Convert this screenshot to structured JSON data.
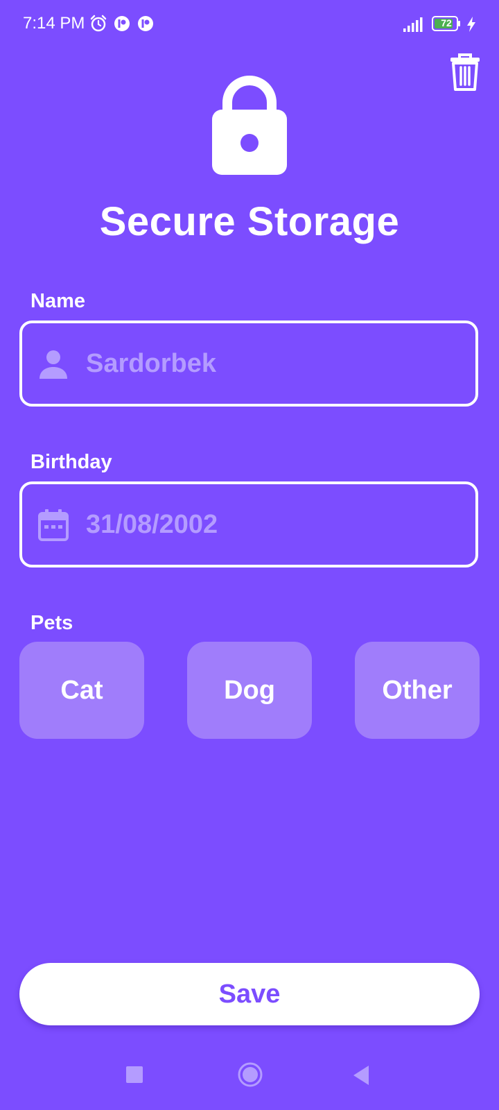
{
  "status_bar": {
    "time": "7:14 PM",
    "battery_level": "72",
    "icons": [
      "alarm-icon",
      "app-notification-icon",
      "app-notification-icon",
      "signal-icon",
      "battery-icon",
      "charging-icon"
    ]
  },
  "header": {
    "title": "Secure Storage",
    "lock_icon": "lock-icon",
    "delete_icon": "trash-icon"
  },
  "form": {
    "name": {
      "label": "Name",
      "value": "Sardorbek",
      "icon": "person-icon"
    },
    "birthday": {
      "label": "Birthday",
      "value": "31/08/2002",
      "icon": "calendar-icon"
    },
    "pets": {
      "label": "Pets",
      "options": [
        "Cat",
        "Dog",
        "Other"
      ]
    }
  },
  "save_label": "Save",
  "nav": {
    "icons": [
      "recents-square-icon",
      "home-circle-icon",
      "back-triangle-icon"
    ]
  },
  "colors": {
    "background": "#7c4dff",
    "chip": "#a07dfb",
    "field_text": "#b49cff",
    "white": "#ffffff"
  }
}
